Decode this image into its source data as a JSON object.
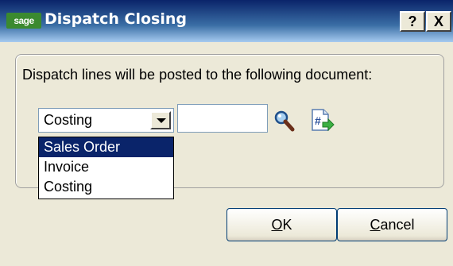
{
  "window": {
    "logo": "sage",
    "title": "Dispatch Closing",
    "help_label": "?",
    "close_label": "X"
  },
  "dialog": {
    "description": "Dispatch lines will be posted to the following document:",
    "document_type": {
      "value": "Costing",
      "options": [
        "Sales Order",
        "Invoice",
        "Costing"
      ],
      "highlighted": "Sales Order"
    },
    "document_code": {
      "value": ""
    },
    "icons": {
      "lookup": "magnifier-lookup-icon",
      "document": "document-hash-arrow-icon"
    }
  },
  "buttons": {
    "ok": {
      "mnemonic": "O",
      "rest": "K"
    },
    "cancel": {
      "mnemonic": "C",
      "rest": "ancel"
    }
  },
  "colors": {
    "titlebar_start": "#0a246a",
    "titlebar_end": "#a6caf0",
    "selection": "#0a246a",
    "dialog_bg": "#ece9d8"
  }
}
